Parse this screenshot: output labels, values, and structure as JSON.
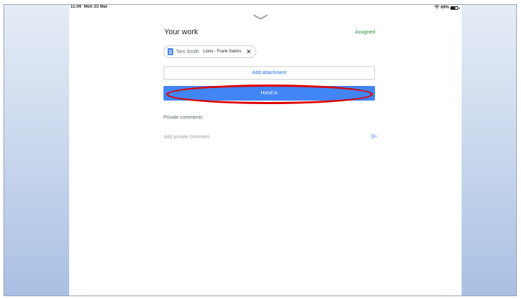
{
  "status_bar": {
    "time": "11:06",
    "date": "Mon 23 Mar",
    "battery": "69%",
    "wifi_icon": "wifi-icon",
    "battery_icon": "battery-icon"
  },
  "sheet": {
    "handle_icon": "chevron-down-icon",
    "title": "Your work",
    "status": "Assigned"
  },
  "attachment": {
    "owner": "Tom Smith",
    "file_name": "Lions - Frank Swims",
    "icon": "google-docs-icon",
    "remove_label": "✕"
  },
  "actions": {
    "add_attachment_label": "Add attachment",
    "hand_in_label": "Hand in"
  },
  "comments": {
    "heading": "Private comments",
    "placeholder": "Add private comment",
    "send_icon": "send-icon"
  },
  "colors": {
    "accent": "#4285f4",
    "link": "#1a73e8",
    "status_green": "#1e8e3e",
    "highlight": "#e00000"
  }
}
